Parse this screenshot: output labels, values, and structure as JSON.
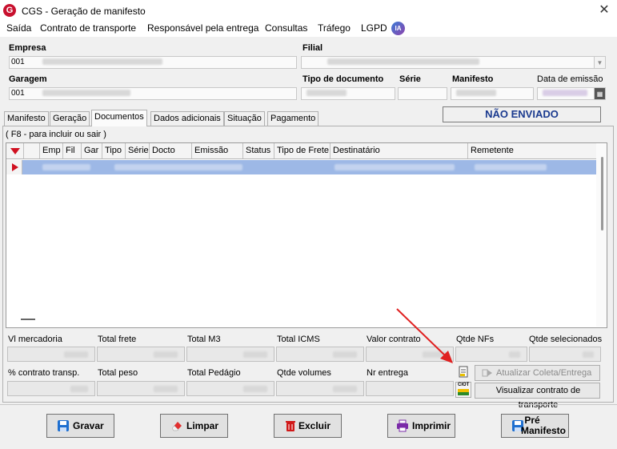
{
  "window": {
    "title": "CGS - Geração de manifesto",
    "logo_letter": "G",
    "close": "✕"
  },
  "menu": {
    "items": [
      "Saída",
      "Contrato de transporte",
      "Responsável pela entrega",
      "Consultas",
      "Tráfego",
      "LGPD"
    ],
    "ia_badge": "IA"
  },
  "form": {
    "empresa_label": "Empresa",
    "empresa_value": "001",
    "filial_label": "Filial",
    "garagem_label": "Garagem",
    "garagem_value": "001",
    "tipo_documento_label": "Tipo de documento",
    "serie_label": "Série",
    "manifesto_label": "Manifesto",
    "data_emissao_label": "Data de emissão"
  },
  "status": {
    "text": "NÃO ENVIADO",
    "color": "#1a3a8f"
  },
  "tabs": [
    {
      "label": "Manifesto",
      "active": false
    },
    {
      "label": "Geração",
      "active": false
    },
    {
      "label": "Documentos",
      "active": true
    },
    {
      "label": "Dados adicionais",
      "active": false
    },
    {
      "label": "Situação",
      "active": false
    },
    {
      "label": "Pagamento",
      "active": false
    }
  ],
  "hint": "( F8 - para incluir ou sair )",
  "grid": {
    "columns": [
      "Emp",
      "Fil",
      "Gar",
      "Tipo",
      "Série",
      "Docto",
      "Emissão",
      "Status",
      "Tipo de Frete",
      "Destinatário",
      "Remetente"
    ],
    "selected_row_color": "#9db8e6"
  },
  "totals": {
    "row1": [
      "Vl mercadoria",
      "Total frete",
      "Total M3",
      "Total ICMS",
      "Valor contrato",
      "Qtde NFs",
      "Qtde selecionados"
    ],
    "row2": [
      "% contrato transp.",
      "Total peso",
      "Total Pedágio",
      "Qtde volumes",
      "Nr entrega"
    ]
  },
  "actions": {
    "atualizar": "Atualizar Coleta/Entrega",
    "visualizar": "Visualizar contrato de transporte",
    "ciot_label": "CIOT"
  },
  "buttons": {
    "gravar": "Gravar",
    "limpar": "Limpar",
    "excluir": "Excluir",
    "imprimir": "Imprimir",
    "pre_manifesto_1": "Pré",
    "pre_manifesto_2": "Manifesto"
  },
  "colors": {
    "accent_red": "#c8102e",
    "arrow_red": "#e02020"
  }
}
